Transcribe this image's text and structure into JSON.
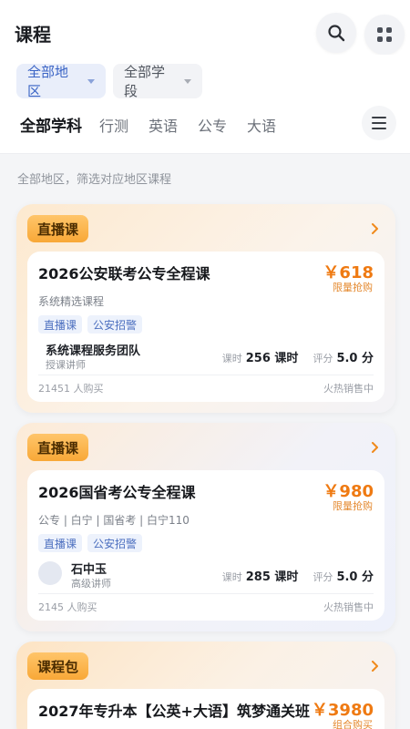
{
  "header": {
    "title": "课程"
  },
  "filters": {
    "region": "全部地区",
    "stage": "全部学段"
  },
  "tabs": [
    {
      "label": "全部学科"
    },
    {
      "label": "行测"
    },
    {
      "label": "英语"
    },
    {
      "label": "公专"
    },
    {
      "label": "大语"
    }
  ],
  "region_hint": "全部地区，筛选对应地区课程",
  "colors": {
    "accent": "#ef7a12",
    "badge": "#f8a837",
    "tag_text": "#4c6fbf",
    "filter_active": "#3a64c5"
  },
  "courses": [
    {
      "badge": "直播课",
      "title": "2026公安联考公专全程课",
      "price": "￥618",
      "price_tag": "限量抢购",
      "subtitle": "系统精选课程",
      "tags": [
        "直播课",
        "公安招警"
      ],
      "teacher_name": "系统课程服务团队",
      "teacher_role": "授课讲师",
      "hours_label": "课时",
      "hours_value": "256 课时",
      "rating_label": "评分",
      "rating_value": "5.0 分",
      "buyers": "21451 人购买",
      "status": "火热销售中"
    },
    {
      "badge": "直播课",
      "title": "2026国省考公专全程课",
      "price": "￥980",
      "price_tag": "限量抢购",
      "subtitle": "公专 | 白宁 | 国省考 | 白宁110",
      "tags": [
        "直播课",
        "公安招警"
      ],
      "teacher_name": "石中玉",
      "teacher_role": "高级讲师",
      "hours_label": "课时",
      "hours_value": "285 课时",
      "rating_label": "评分",
      "rating_value": "5.0 分",
      "buyers": "2145 人购买",
      "status": "火热销售中"
    },
    {
      "badge": "课程包",
      "title": "2027年专升本【公英+大语】筑梦通关班",
      "price": "￥3980",
      "price_tag": "组合购买"
    }
  ]
}
